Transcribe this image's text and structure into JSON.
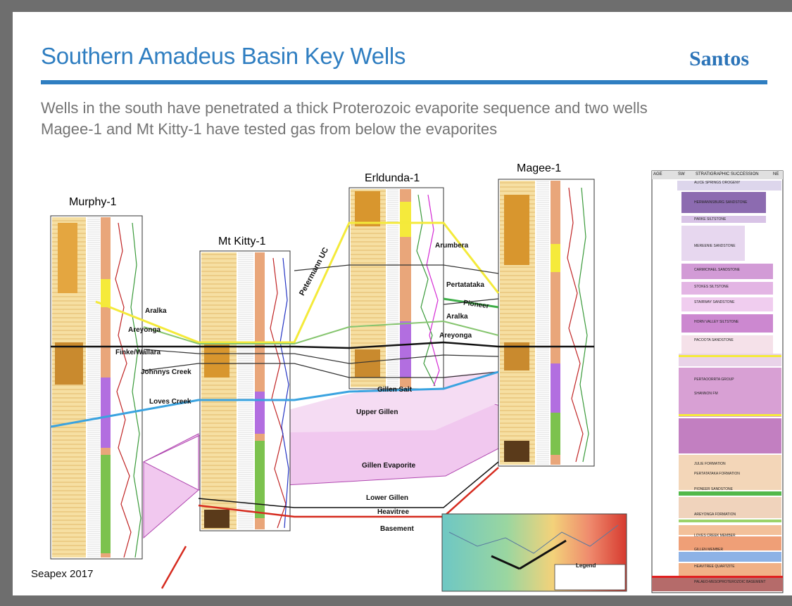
{
  "slide": {
    "title": "Southern Amadeus Basin Key Wells",
    "brand": "Santos",
    "subtitle_line1": "Wells in the south have penetrated a thick Proterozoic evaporite sequence and two wells",
    "subtitle_line2": "Magee-1 and Mt Kitty-1 have tested gas from below the evaporites",
    "footer": "Seapex 2017"
  },
  "wells": {
    "murphy": "Murphy-1",
    "mtkitty": "Mt Kitty-1",
    "erldunda": "Erldunda-1",
    "magee": "Magee-1"
  },
  "units": {
    "aralka_left": "Aralka",
    "areyonga_left": "Areyonga",
    "finke": "Finke/Wallara",
    "johnnys": "Johnnys Creek",
    "loves": "Loves Creek",
    "petermann": "Petermann UC",
    "arumbera": "Arumbera",
    "pertatataka": "Pertatataka",
    "pioneer": "Pioneer",
    "aralka_right": "Aralka",
    "areyonga_right": "Areyonga",
    "gillen_salt": "Gillen Salt",
    "upper_gillen": "Upper Gillen",
    "gillen_evaporite": "Gillen Evaporite",
    "lower_gillen": "Lower Gillen",
    "heavitree": "Heavitree",
    "basement": "Basement"
  },
  "strat_column": {
    "header_age": "AGE",
    "header_sw": "SW",
    "header_title": "STRATIGRAPHIC SUCCESSION",
    "header_ne": "NE",
    "formations": [
      "ALICE SPRINGS OROGENY",
      "HERMANNSBURG SANDSTONE",
      "PARKE SILTSTONE",
      "MEREENIE SANDSTONE",
      "CARMICHAEL SANDSTONE",
      "STOKES SILTSTONE",
      "STAIRWAY SANDSTONE",
      "HORN VALLEY SILTSTONE",
      "PACOOTA SANDSTONE",
      "PERTAOORRTA GROUP",
      "SHANNON FM",
      "JULIE FORMATION",
      "PERTATATAKA FORMATION",
      "PIONEER SANDSTONE",
      "AREYONGA FORMATION",
      "LOVES CREEK MEMBER",
      "GILLEN MEMBER",
      "HEAVITREE QUARTZITE",
      "PALAEO-MESOPROTEROZOIC BASEMENT"
    ]
  },
  "map_legend": "Legend",
  "colors": {
    "title_blue": "#2f7ec1",
    "gillen_fill": "#f1c8ef",
    "yellow_line": "#f4ea3a",
    "green_line": "#3fae49",
    "blue_line": "#3aa3e0",
    "red_line": "#d62b1f"
  }
}
